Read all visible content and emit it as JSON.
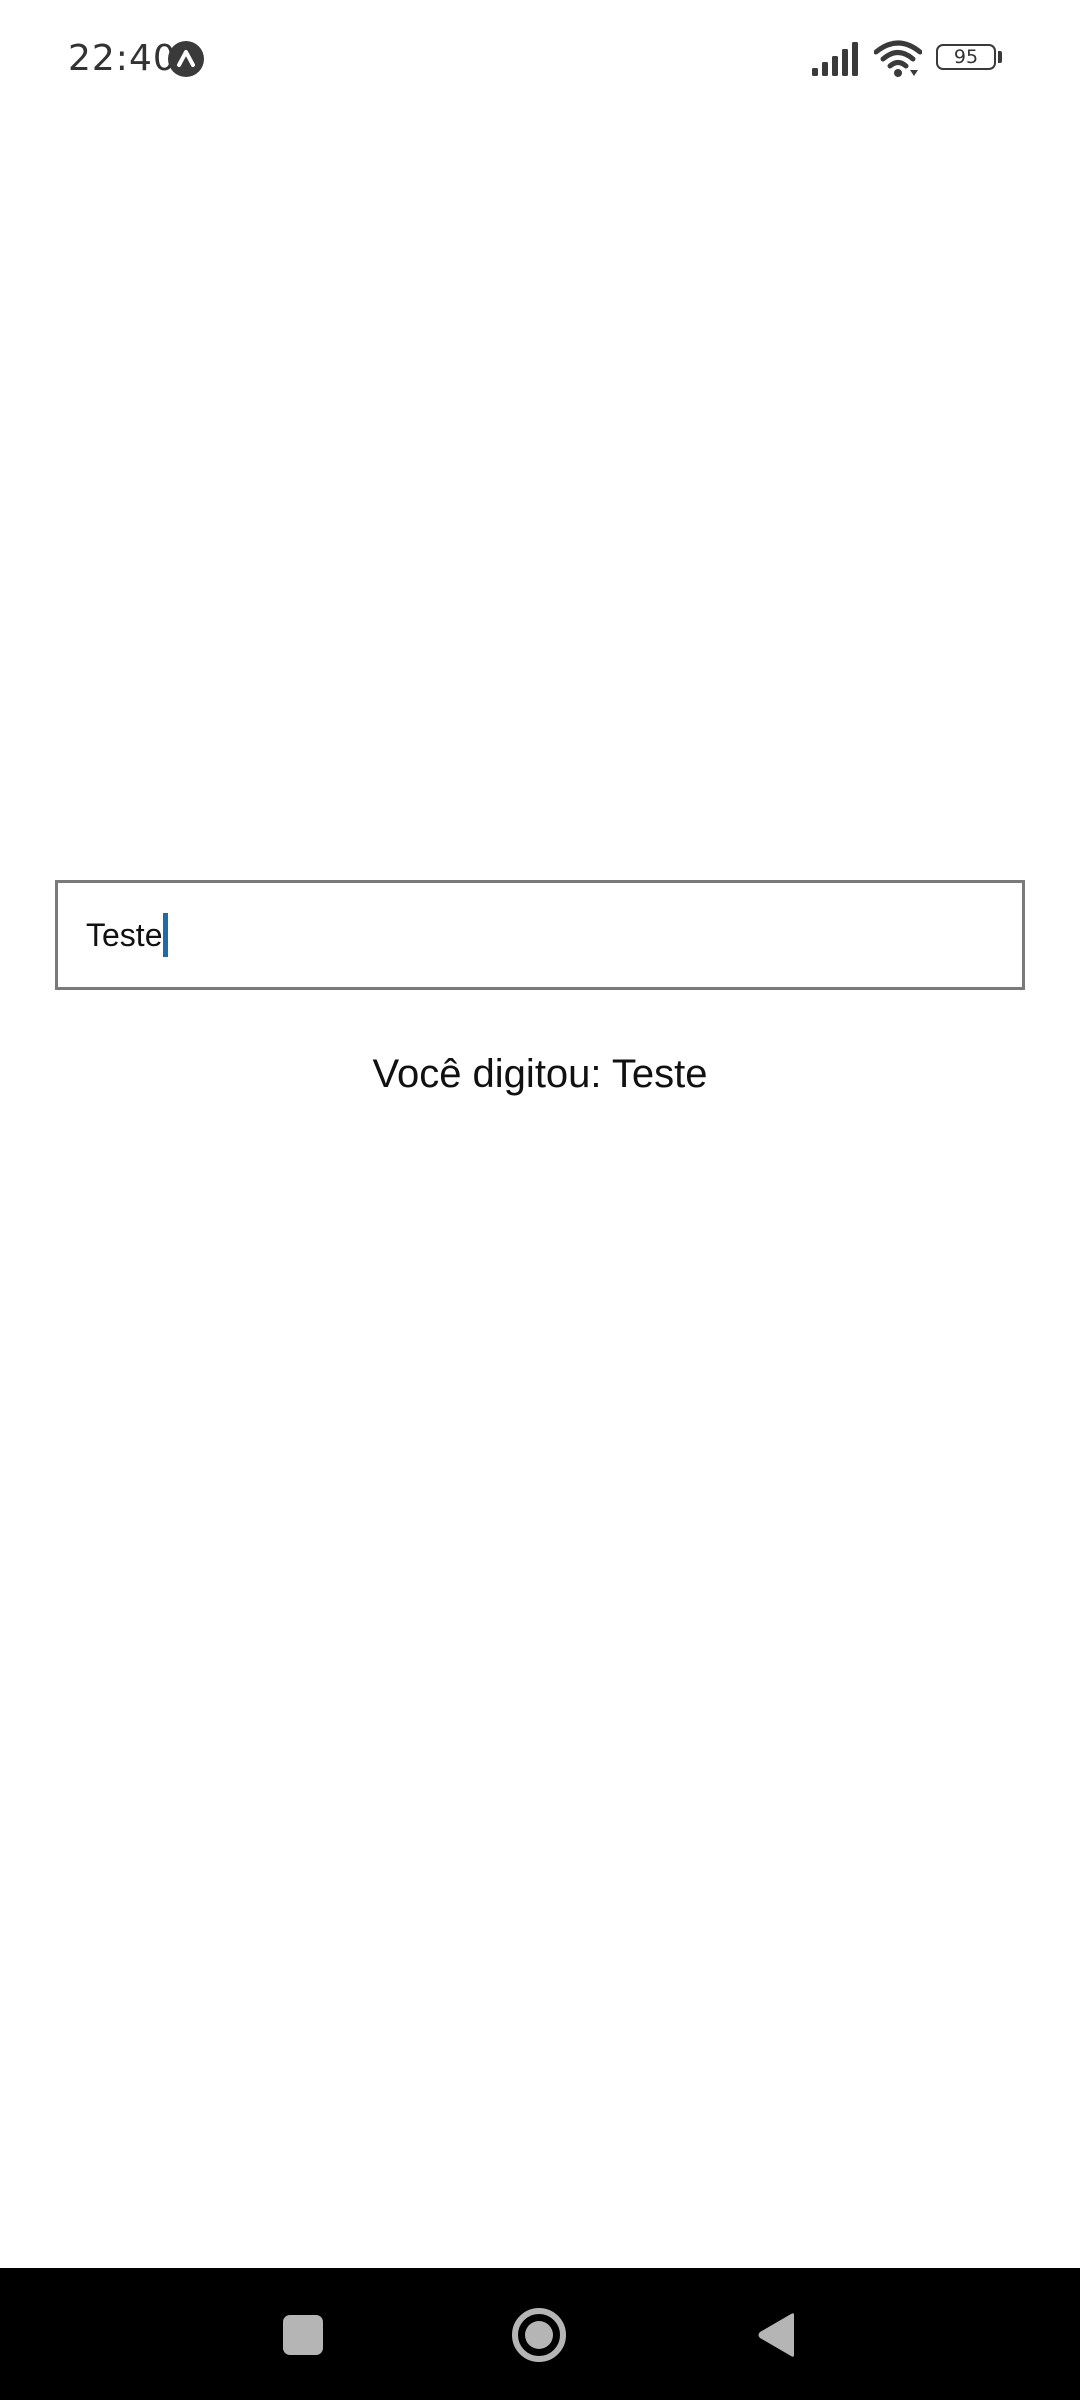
{
  "status_bar": {
    "time": "22:40",
    "app_icon": "app-notification-icon",
    "signal_icon": "signal-icon",
    "wifi_icon": "wifi-icon",
    "battery_level": "95"
  },
  "main": {
    "input": {
      "value": "Teste",
      "placeholder": ""
    },
    "output_text": "Você digitou: Teste"
  },
  "nav_bar": {
    "recents_icon": "recents-icon",
    "home_icon": "home-icon",
    "back_icon": "back-icon"
  },
  "colors": {
    "cursor": "#1f6aa8",
    "input_border": "#7a7a7a",
    "nav_background": "#000000"
  }
}
